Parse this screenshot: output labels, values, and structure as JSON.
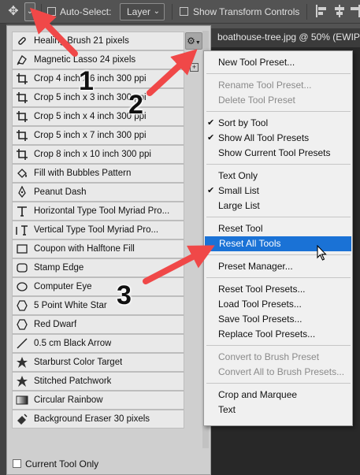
{
  "options_bar": {
    "auto_select_label": "Auto-Select:",
    "layer_select_value": "Layer",
    "show_transform_label": "Show Transform Controls"
  },
  "document": {
    "tab_title": "boathouse-tree.jpg @ 50% (EWIP"
  },
  "presets": {
    "items": [
      {
        "label": "Healing Brush 21 pixels",
        "icon": "healing-brush-icon"
      },
      {
        "label": "Magnetic Lasso 24 pixels",
        "icon": "magnetic-lasso-icon"
      },
      {
        "label": "Crop 4 inch x 6 inch 300 ppi",
        "icon": "crop-icon"
      },
      {
        "label": "Crop 5 inch x 3 inch 300 ppi",
        "icon": "crop-icon"
      },
      {
        "label": "Crop 5 inch x 4 inch 300 ppi",
        "icon": "crop-icon"
      },
      {
        "label": "Crop 5 inch x 7 inch 300 ppi",
        "icon": "crop-icon"
      },
      {
        "label": "Crop 8 inch x 10 inch 300 ppi",
        "icon": "crop-icon"
      },
      {
        "label": "Fill with Bubbles Pattern",
        "icon": "paint-bucket-icon"
      },
      {
        "label": "Peanut Dash",
        "icon": "pen-icon"
      },
      {
        "label": "Horizontal Type Tool Myriad Pro...",
        "icon": "type-icon"
      },
      {
        "label": "Vertical Type Tool Myriad Pro...",
        "icon": "vertical-type-icon"
      },
      {
        "label": "Coupon with Halftone Fill",
        "icon": "rectangle-icon"
      },
      {
        "label": "Stamp Edge",
        "icon": "rounded-rectangle-icon"
      },
      {
        "label": "Computer Eye",
        "icon": "ellipse-icon"
      },
      {
        "label": "5 Point White Star",
        "icon": "polygon-icon"
      },
      {
        "label": "Red Dwarf",
        "icon": "polygon-icon"
      },
      {
        "label": "0.5 cm Black Arrow",
        "icon": "line-icon"
      },
      {
        "label": "Starburst Color Target",
        "icon": "custom-shape-icon"
      },
      {
        "label": "Stitched Patchwork",
        "icon": "custom-shape-icon"
      },
      {
        "label": "Circular Rainbow",
        "icon": "gradient-icon"
      },
      {
        "label": "Background Eraser 30 pixels",
        "icon": "background-eraser-icon"
      }
    ],
    "current_tool_only_label": "Current Tool Only"
  },
  "menu": {
    "groups": [
      [
        {
          "label": "New Tool Preset...",
          "enabled": true
        }
      ],
      [
        {
          "label": "Rename Tool Preset...",
          "enabled": false
        },
        {
          "label": "Delete Tool Preset",
          "enabled": false
        }
      ],
      [
        {
          "label": "Sort by Tool",
          "enabled": true,
          "checked": true
        },
        {
          "label": "Show All Tool Presets",
          "enabled": true,
          "checked": true
        },
        {
          "label": "Show Current Tool Presets",
          "enabled": true
        }
      ],
      [
        {
          "label": "Text Only",
          "enabled": true
        },
        {
          "label": "Small List",
          "enabled": true,
          "checked": true
        },
        {
          "label": "Large List",
          "enabled": true
        }
      ],
      [
        {
          "label": "Reset Tool",
          "enabled": true
        },
        {
          "label": "Reset All Tools",
          "enabled": true,
          "highlighted": true
        }
      ],
      [
        {
          "label": "Preset Manager...",
          "enabled": true
        }
      ],
      [
        {
          "label": "Reset Tool Presets...",
          "enabled": true
        },
        {
          "label": "Load Tool Presets...",
          "enabled": true
        },
        {
          "label": "Save Tool Presets...",
          "enabled": true
        },
        {
          "label": "Replace Tool Presets...",
          "enabled": true
        }
      ],
      [
        {
          "label": "Convert to Brush Preset",
          "enabled": false
        },
        {
          "label": "Convert All to Brush Presets...",
          "enabled": false
        }
      ],
      [
        {
          "label": "Crop and Marquee",
          "enabled": true
        },
        {
          "label": "Text",
          "enabled": true
        }
      ]
    ]
  },
  "annotations": {
    "step1": "1",
    "step2": "2",
    "step3": "3",
    "arrow_color": "#f04848"
  },
  "colors": {
    "highlight": "#1a72d6",
    "panel_bg": "#cfcfcf",
    "item_bg": "#e9e9e9"
  }
}
